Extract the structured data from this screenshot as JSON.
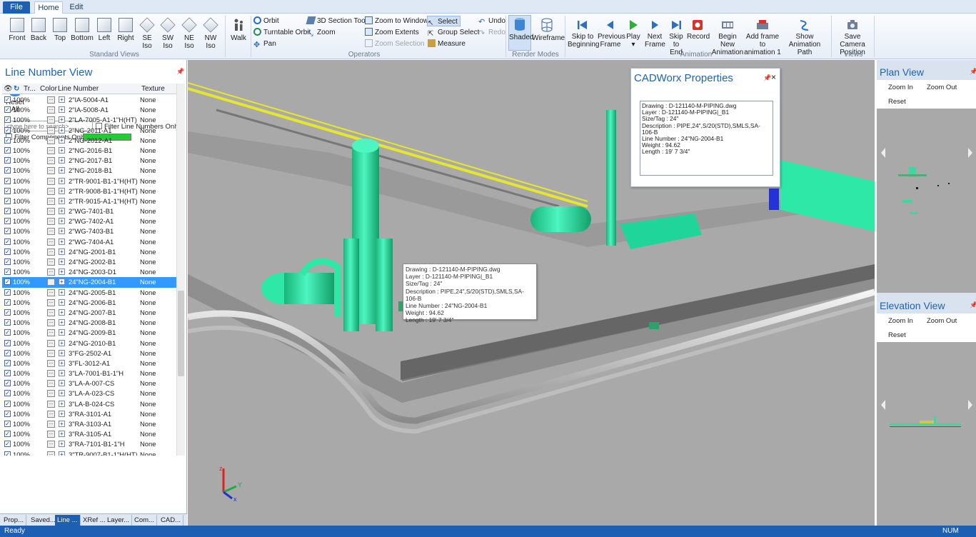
{
  "ribbon": {
    "tabs": [
      "File",
      "Home",
      "Edit"
    ],
    "standard_views": {
      "group_label": "Standard Views",
      "buttons": [
        {
          "l1": "Front",
          "l2": ""
        },
        {
          "l1": "Back",
          "l2": ""
        },
        {
          "l1": "Top",
          "l2": ""
        },
        {
          "l1": "Bottom",
          "l2": ""
        },
        {
          "l1": "Left",
          "l2": ""
        },
        {
          "l1": "Right",
          "l2": ""
        },
        {
          "l1": "SE",
          "l2": "Iso"
        },
        {
          "l1": "SW",
          "l2": "Iso"
        },
        {
          "l1": "NE",
          "l2": "Iso"
        },
        {
          "l1": "NW",
          "l2": "Iso"
        }
      ]
    },
    "walk": "Walk",
    "operators": {
      "group_label": "Operators",
      "orbit": "Orbit",
      "turntable_orbit": "Turntable Orbit",
      "pan": "Pan",
      "section_tool": "3D Section Tool",
      "zoom": "Zoom",
      "zoom_to_window": "Zoom to Window",
      "zoom_extents": "Zoom Extents",
      "zoom_selection": "Zoom Selection",
      "select": "Select",
      "group_select": "Group Select",
      "measure": "Measure",
      "undo": "Undo",
      "redo": "Redo"
    },
    "render_modes": {
      "group_label": "Render Modes",
      "shaded": "Shaded",
      "wireframe": "Wireframe"
    },
    "animation": {
      "group_label": "Animation",
      "skip_to_beginning": [
        "Skip to",
        "Beginning"
      ],
      "previous_frame": [
        "Previous",
        "Frame"
      ],
      "play": [
        "Play",
        "▾"
      ],
      "next_frame": [
        "Next",
        "Frame"
      ],
      "skip_to_end": [
        "Skip",
        "to End"
      ],
      "record": [
        "Record",
        ""
      ],
      "begin_new": [
        "Begin New",
        "Animation"
      ],
      "add_frame": [
        "Add frame to",
        "animation 1"
      ],
      "show_path": [
        "Show Animation",
        "Path"
      ]
    },
    "views": {
      "group_label": "Views",
      "save_camera": [
        "Save Camera",
        "Position"
      ]
    }
  },
  "line_number_view": {
    "title": "Line Number View",
    "reset_label": [
      "Reset",
      "All"
    ],
    "search_placeholder": "<type here to search>",
    "filter_line_numbers_only": "Filter Line Numbers Only",
    "filter_components_only": "Filter Components Only",
    "columns": {
      "transparency": "Tr...",
      "color": "Color",
      "line_number": "Line Number",
      "texture": "Texture"
    },
    "rows": [
      {
        "pct": "100%",
        "ln": "2\"IA-5004-A1",
        "tex": "None"
      },
      {
        "pct": "100%",
        "ln": "2\"IA-5008-A1",
        "tex": "None"
      },
      {
        "pct": "100%",
        "ln": "2\"LA-7005-A1-1\"H(HT)",
        "tex": "None"
      },
      {
        "pct": "100%",
        "ln": "2\"NG-2011-A1",
        "tex": "None"
      },
      {
        "pct": "100%",
        "ln": "2\"NG-2012-A1",
        "tex": "None"
      },
      {
        "pct": "100%",
        "ln": "2\"NG-2016-B1",
        "tex": "None"
      },
      {
        "pct": "100%",
        "ln": "2\"NG-2017-B1",
        "tex": "None"
      },
      {
        "pct": "100%",
        "ln": "2\"NG-2018-B1",
        "tex": "None"
      },
      {
        "pct": "100%",
        "ln": "2\"TR-9001-B1-1\"H(HT)",
        "tex": "None"
      },
      {
        "pct": "100%",
        "ln": "2\"TR-9008-B1-1\"H(HT)",
        "tex": "None"
      },
      {
        "pct": "100%",
        "ln": "2\"TR-9015-A1-1\"H(HT)",
        "tex": "None"
      },
      {
        "pct": "100%",
        "ln": "2\"WG-7401-B1",
        "tex": "None"
      },
      {
        "pct": "100%",
        "ln": "2\"WG-7402-A1",
        "tex": "None"
      },
      {
        "pct": "100%",
        "ln": "2\"WG-7403-B1",
        "tex": "None"
      },
      {
        "pct": "100%",
        "ln": "2\"WG-7404-A1",
        "tex": "None"
      },
      {
        "pct": "100%",
        "ln": "24\"NG-2001-B1",
        "tex": "None"
      },
      {
        "pct": "100%",
        "ln": "24\"NG-2002-B1",
        "tex": "None"
      },
      {
        "pct": "100%",
        "ln": "24\"NG-2003-D1",
        "tex": "None"
      },
      {
        "pct": "100%",
        "ln": "24\"NG-2004-B1",
        "tex": "None",
        "selected": true
      },
      {
        "pct": "100%",
        "ln": "24\"NG-2005-B1",
        "tex": "None"
      },
      {
        "pct": "100%",
        "ln": "24\"NG-2006-B1",
        "tex": "None"
      },
      {
        "pct": "100%",
        "ln": "24\"NG-2007-B1",
        "tex": "None"
      },
      {
        "pct": "100%",
        "ln": "24\"NG-2008-B1",
        "tex": "None"
      },
      {
        "pct": "100%",
        "ln": "24\"NG-2009-B1",
        "tex": "None"
      },
      {
        "pct": "100%",
        "ln": "24\"NG-2010-B1",
        "tex": "None"
      },
      {
        "pct": "100%",
        "ln": "3\"FG-2502-A1",
        "tex": "None"
      },
      {
        "pct": "100%",
        "ln": "3\"FL-3012-A1",
        "tex": "None"
      },
      {
        "pct": "100%",
        "ln": "3\"LA-7001-B1-1\"H",
        "tex": "None"
      },
      {
        "pct": "100%",
        "ln": "3\"LA-A-007-CS",
        "tex": "None"
      },
      {
        "pct": "100%",
        "ln": "3\"LA-A-023-CS",
        "tex": "None"
      },
      {
        "pct": "100%",
        "ln": "3\"LA-B-024-CS",
        "tex": "None"
      },
      {
        "pct": "100%",
        "ln": "3\"RA-3101-A1",
        "tex": "None"
      },
      {
        "pct": "100%",
        "ln": "3\"RA-3103-A1",
        "tex": "None"
      },
      {
        "pct": "100%",
        "ln": "3\"RA-3105-A1",
        "tex": "None"
      },
      {
        "pct": "100%",
        "ln": "3\"RA-7101-B1-1\"H",
        "tex": "None"
      },
      {
        "pct": "100%",
        "ln": "3\"TR-9007-B1-1\"H(HT)",
        "tex": "None"
      }
    ],
    "bottom_tabs": [
      "Prop...",
      "Saved...",
      "Line ...",
      "XRef ...",
      "Layer...",
      "Com...",
      "CAD..."
    ]
  },
  "cadworx_properties": {
    "title": "CADWorx Properties",
    "lines": [
      "Drawing : D-121140-M-PIPING.dwg",
      "Layer : D-121140-M-PIPING|_B1",
      "Size/Tag : 24\"",
      "Description : PIPE,24\",S/20(STD),SMLS,SA-106-B",
      "Line Number : 24\"NG-2004-B1",
      "Weight : 94.62",
      "Length : 19' 7 3/4\""
    ]
  },
  "tooltip": {
    "lines": [
      "Drawing : D-121140-M-PIPING.dwg",
      "Layer : D-121140-M-PIPING|_B1",
      "Size/Tag : 24\"",
      "Description : PIPE,24\",S/20(STD),SMLS,SA-106-B",
      "Line Number : 24\"NG-2004-B1",
      "Weight : 94.62",
      "Length : 19' 7 3/4\""
    ]
  },
  "plan_view": {
    "title": "Plan View",
    "zoom_in": "Zoom In",
    "zoom_out": "Zoom Out",
    "reset": "Reset"
  },
  "elevation_view": {
    "title": "Elevation View",
    "zoom_in": "Zoom In",
    "zoom_out": "Zoom Out",
    "reset": "Reset"
  },
  "status": {
    "left": "Ready",
    "right": "NUM"
  },
  "colors": {
    "accent": "#1d5fb3",
    "title_blue": "#1d63b8",
    "equipment_green": "#2ee8a8",
    "pipe_yellow": "#e6e62a",
    "viewport_bg": "#a9a9a9",
    "selection": "#3399ff"
  }
}
